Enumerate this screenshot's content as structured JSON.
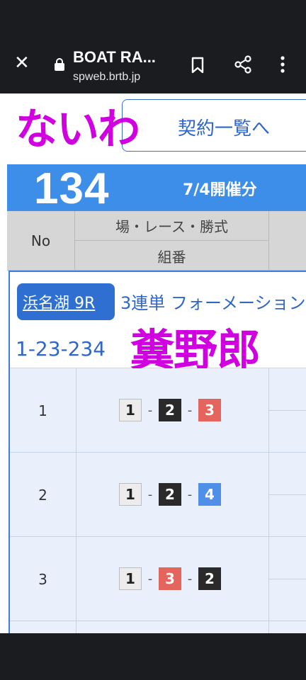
{
  "browser": {
    "title": "BOAT RA...",
    "url": "spweb.brtb.jp"
  },
  "overlay": {
    "top_text": "ないわ",
    "card_text": "糞野郎"
  },
  "contract_button": {
    "label": "契約一覧へ"
  },
  "summary": {
    "count": "134",
    "date_label": "7/4開催分"
  },
  "table_header": {
    "no": "No",
    "venue_race_bet": "場・レース・勝式",
    "combination": "組番"
  },
  "ticket": {
    "venue_race": "浜名湖 9R",
    "bet_type": "3連単 フォーメーション",
    "formation": "1-23-234"
  },
  "rows": [
    {
      "no": "1",
      "boats": [
        "1",
        "2",
        "3"
      ]
    },
    {
      "no": "2",
      "boats": [
        "1",
        "2",
        "4"
      ]
    },
    {
      "no": "3",
      "boats": [
        "1",
        "3",
        "2"
      ]
    }
  ],
  "colors": {
    "header_blue": "#3d8ee8",
    "overlay_magenta": "#d000e0",
    "boat_1": "#ececec",
    "boat_2": "#2a2a2a",
    "boat_3": "#e4645e",
    "boat_4": "#4f8fe8"
  }
}
